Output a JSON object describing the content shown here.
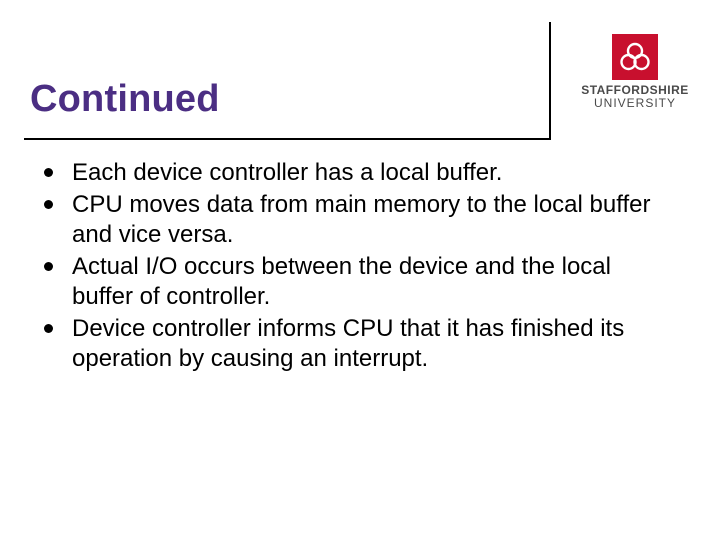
{
  "title": "Continued",
  "logo": {
    "line1": "STAFFORDSHIRE",
    "line2": "UNIVERSITY",
    "color": "#c8102e"
  },
  "bullets": [
    "Each device controller has a local buffer.",
    "CPU moves data from main memory to the local buffer and vice versa.",
    "Actual I/O occurs between the device and the local buffer of controller.",
    "Device controller informs CPU that it has finished its operation by causing an interrupt."
  ]
}
